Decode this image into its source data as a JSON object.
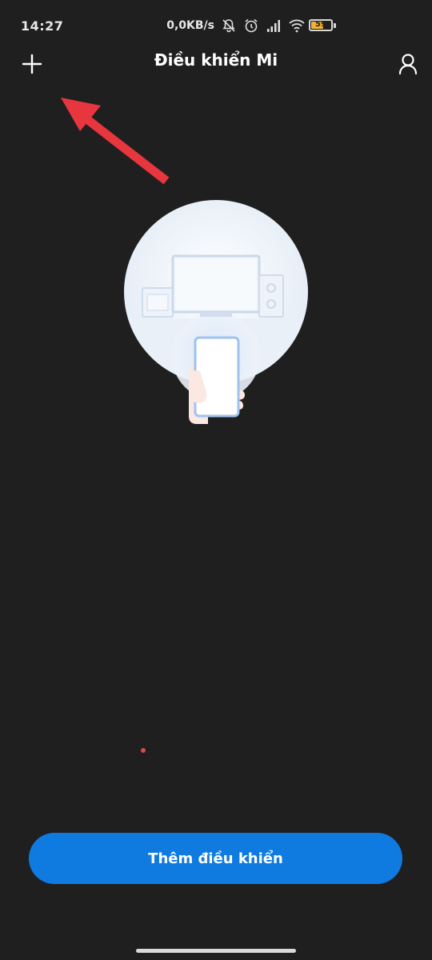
{
  "status_bar": {
    "time": "14:27",
    "network_speed": "0,0KB/s",
    "battery_level": "59",
    "icons": [
      "notifications-off-icon",
      "alarm-icon",
      "signal-icon",
      "wifi-icon",
      "battery-icon"
    ]
  },
  "header": {
    "title": "Điều khiển Mi",
    "add_icon": "plus-icon",
    "profile_icon": "user-icon"
  },
  "annotation": {
    "arrow_color": "#e8363e"
  },
  "illustration": {
    "name": "phone-remote-illustration"
  },
  "actions": {
    "add_remote_label": "Thêm điều khiển"
  },
  "colors": {
    "background": "#1f1f1f",
    "primary": "#0f7be0",
    "arrow": "#e8363e",
    "battery": "#f2b233"
  }
}
